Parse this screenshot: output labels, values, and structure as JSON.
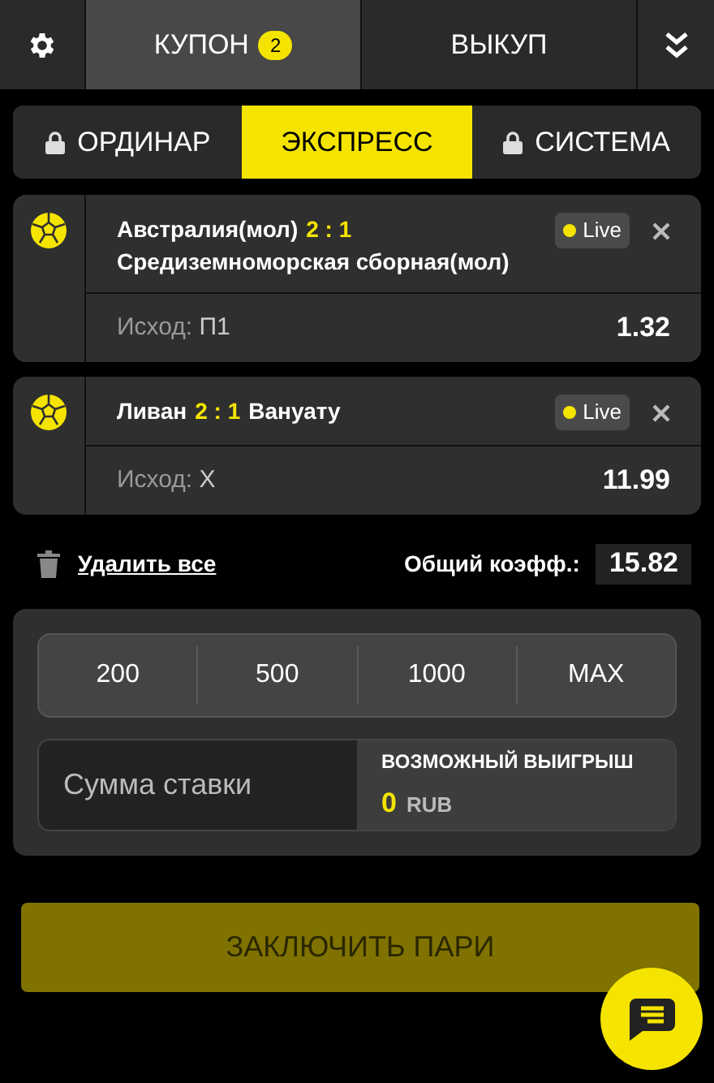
{
  "tabs": [
    {
      "label": "КУПОН",
      "badge": "2",
      "selected": true
    },
    {
      "label": "ВЫКУП",
      "selected": false
    }
  ],
  "bet_types": [
    {
      "label": "ОРДИНАР",
      "locked": true,
      "selected": false
    },
    {
      "label": "ЭКСПРЕСС",
      "locked": false,
      "selected": true
    },
    {
      "label": "СИСТЕМА",
      "locked": true,
      "selected": false
    }
  ],
  "bets": [
    {
      "team1": "Австралия(мол)",
      "score": "2 : 1",
      "team2": "Средиземноморская сборная(мол)",
      "live": "Live",
      "outcome_label": "Исход:",
      "outcome": "П1",
      "odds": "1.32"
    },
    {
      "team1": "Ливан",
      "score": "2 : 1",
      "team2": "Вануату",
      "live": "Live",
      "outcome_label": "Исход:",
      "outcome": "X",
      "odds": "11.99"
    }
  ],
  "delete_all": "Удалить все",
  "total_odds": {
    "label": "Общий коэфф.:",
    "value": "15.82"
  },
  "presets": [
    "200",
    "500",
    "1000",
    "MAX"
  ],
  "stake": {
    "placeholder": "Сумма ставки"
  },
  "possible_win": {
    "label": "ВОЗМОЖНЫЙ ВЫИГРЫШ",
    "value": "0",
    "currency": "RUB"
  },
  "submit": {
    "label": "ЗАКЛЮЧИТЬ ПАРИ",
    "disabled": true
  }
}
